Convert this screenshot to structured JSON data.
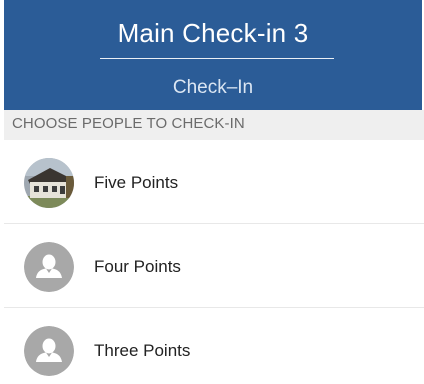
{
  "app": {
    "title": "Main Check-in 3",
    "subtitle": "Check–In"
  },
  "section": {
    "label": "CHOOSE PEOPLE TO CHECK-IN"
  },
  "people": [
    {
      "name": "Five Points",
      "avatar": "building-photo"
    },
    {
      "name": "Four Points",
      "avatar": "default-person-icon"
    },
    {
      "name": "Three Points",
      "avatar": "default-person-icon"
    }
  ],
  "colors": {
    "header_bg": "#2b5c97",
    "section_bg": "#efefef",
    "avatar_gray": "#a8a8a8"
  }
}
